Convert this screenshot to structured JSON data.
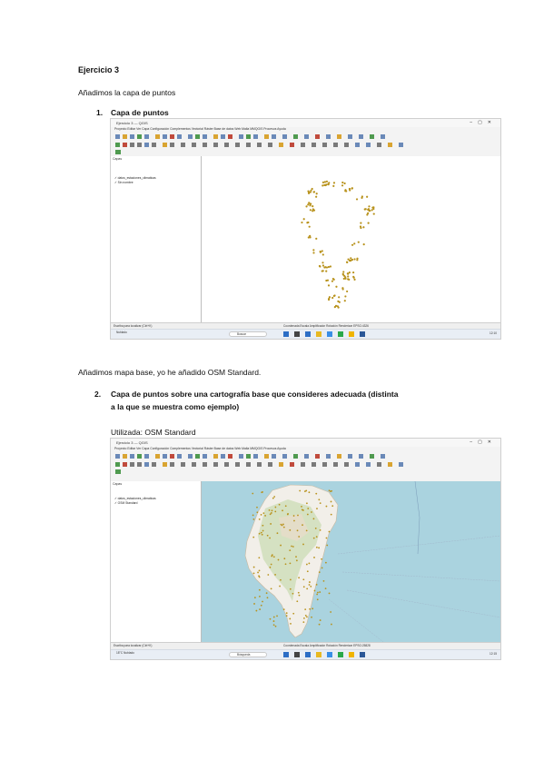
{
  "doc": {
    "title": "Ejercicio 3",
    "intro": "Añadimos la capa de puntos",
    "item1": {
      "number": "1.",
      "label": "Capa de puntos"
    },
    "mid_text": "Añadimos mapa base, yo he añadido OSM Standard.",
    "item2": {
      "number": "2.",
      "label_line1": "Capa de puntos sobre una cartografía base que consideres adecuada (distinta",
      "label_line2": "a la que se muestra como ejemplo)"
    },
    "used": "Utilizada: OSM Standard"
  },
  "shot1": {
    "window_title": "Ejercicio 3 — QGIS",
    "menu": "Proyecto  Editar  Ver  Capa  Configuración  Complementos  Vectorial  Ráster  Base de datos  Web  Malla  MMQGIS  Procesos  Ayuda",
    "panel_title": "Capas",
    "layers": [
      "✓  datos_estaciones_climaticas",
      "✓  Sin nombre"
    ],
    "status_left": "Escriba para localizar (Ctrl+K)",
    "status_right": "Coordenada   Escala   Amplificador   Rotación   Renderizar   EPSG:4326",
    "search": "Buscar",
    "weather": "Nublado",
    "tray_time": "12:10"
  },
  "shot2": {
    "window_title": "Ejercicio 3 — QGIS",
    "menu": "Proyecto  Editar  Ver  Capa  Configuración  Complementos  Vectorial  Ráster  Base de datos  Web  Malla  MMQGIS  Procesos  Ayuda",
    "panel_title": "Capas",
    "layers": [
      "✓  datos_estaciones_climaticas",
      "✓  OSM Standard"
    ],
    "status_left": "Escriba para localizar (Ctrl+K)",
    "status_right": "Coordenada   Escala   Amplificador   Rotación   Renderizar   EPSG:25828",
    "search": "Búsqueda",
    "weather": "18°C Nublado",
    "tray_time": "12:15"
  },
  "colors": {
    "points": "#b8921c",
    "sea": "#aad3df",
    "land": "#f2efe9",
    "vegetation": "#c9dcb0",
    "taskbar": "#e9eef5"
  }
}
